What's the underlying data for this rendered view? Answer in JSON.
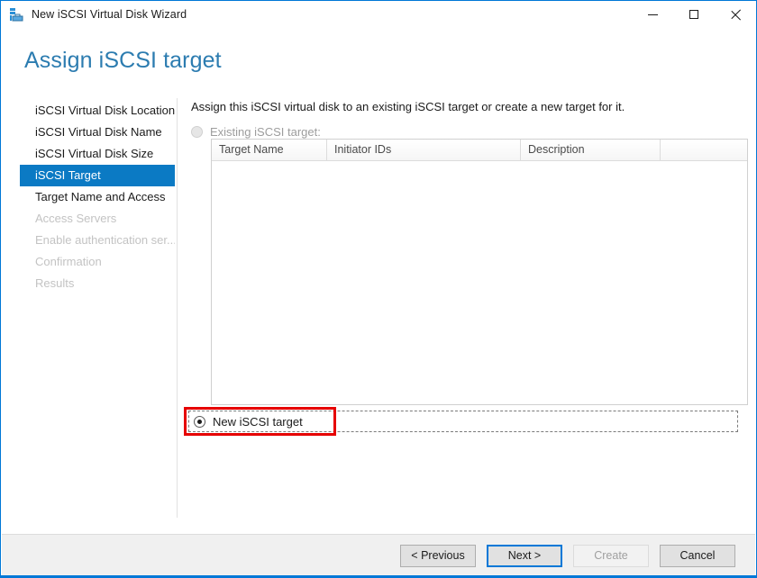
{
  "window": {
    "title": "New iSCSI Virtual Disk Wizard",
    "icon": "iscsi-virtual-disk-icon",
    "accent_color": "#0078d7",
    "controls": {
      "minimize": "minimize-icon",
      "maximize": "maximize-icon",
      "close": "close-icon"
    }
  },
  "page": {
    "heading": "Assign iSCSI target",
    "heading_color": "#2c7cb0"
  },
  "sidebar": {
    "items": [
      {
        "label": "iSCSI Virtual Disk Location",
        "state": "completed"
      },
      {
        "label": "iSCSI Virtual Disk Name",
        "state": "completed"
      },
      {
        "label": "iSCSI Virtual Disk Size",
        "state": "completed"
      },
      {
        "label": "iSCSI Target",
        "state": "selected"
      },
      {
        "label": "Target Name and Access",
        "state": "completed"
      },
      {
        "label": "Access Servers",
        "state": "disabled"
      },
      {
        "label": "Enable authentication ser...",
        "state": "disabled"
      },
      {
        "label": "Confirmation",
        "state": "disabled"
      },
      {
        "label": "Results",
        "state": "disabled"
      }
    ],
    "selected_color": "#0b7ac4"
  },
  "main": {
    "intro": "Assign this iSCSI virtual disk to an existing iSCSI target or create a new target for it.",
    "existing_target": {
      "label": "Existing iSCSI target:",
      "selected": false,
      "enabled": false
    },
    "table": {
      "columns": [
        "Target Name",
        "Initiator IDs",
        "Description",
        ""
      ],
      "rows": []
    },
    "new_target": {
      "label": "New iSCSI target",
      "selected": true,
      "enabled": true,
      "focused": true,
      "annotation_color": "#e60000"
    }
  },
  "footer": {
    "buttons": [
      {
        "label": "< Previous",
        "state": "enabled"
      },
      {
        "label": "Next >",
        "state": "default"
      },
      {
        "label": "Create",
        "state": "disabled"
      },
      {
        "label": "Cancel",
        "state": "enabled"
      }
    ]
  }
}
